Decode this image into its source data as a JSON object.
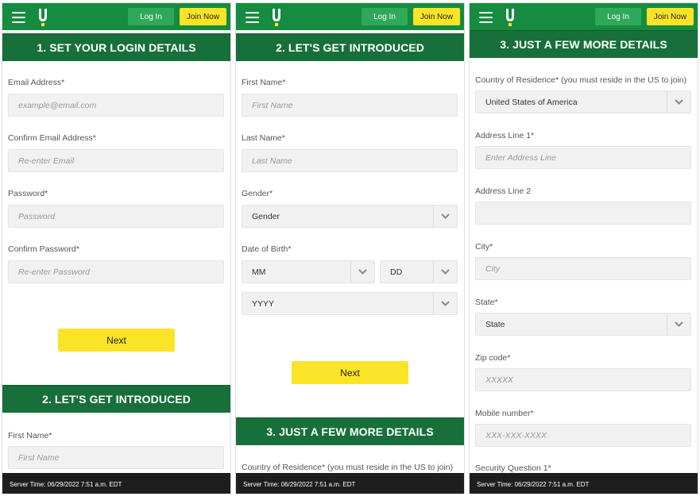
{
  "header": {
    "login_label": "Log In",
    "join_label": "Join Now"
  },
  "sections": {
    "s1": "1. SET YOUR LOGIN DETAILS",
    "s2": "2. LET'S GET INTRODUCED",
    "s3": "3. JUST A FEW MORE DETAILS"
  },
  "login": {
    "email_label": "Email Address*",
    "email_ph": "example@email.com",
    "confirm_email_label": "Confirm Email Address*",
    "confirm_email_ph": "Re-enter Email",
    "password_label": "Password*",
    "password_ph": "Password",
    "confirm_password_label": "Confirm Password*",
    "confirm_password_ph": "Re-enter Password"
  },
  "intro": {
    "first_name_label": "First Name*",
    "first_name_ph": "First Name",
    "last_name_label": "Last Name*",
    "last_name_ph": "Last Name",
    "gender_label": "Gender*",
    "gender_value": "Gender",
    "dob_label": "Date of Birth*",
    "mm": "MM",
    "dd": "DD",
    "yyyy": "YYYY"
  },
  "details": {
    "country_label": "Country of Residence* (you must reside in the US to join)",
    "country_value": "United States of America",
    "addr1_label": "Address Line 1*",
    "addr1_ph": "Enter Address Line",
    "addr2_label": "Address Line 2",
    "city_label": "City*",
    "city_ph": "City",
    "state_label": "State*",
    "state_value": "State",
    "zip_label": "Zip code*",
    "zip_ph": "XXXXX",
    "mobile_label": "Mobile number*",
    "mobile_ph": "XXX-XXX-XXXX",
    "security_label": "Security Question 1*"
  },
  "next_label": "Next",
  "footer": {
    "server_time": "Server Time: 06/29/2022 7:51 a.m. EDT"
  },
  "colors": {
    "brand_green": "#158c3f",
    "dark_green": "#17703a",
    "yellow": "#fbe327"
  }
}
